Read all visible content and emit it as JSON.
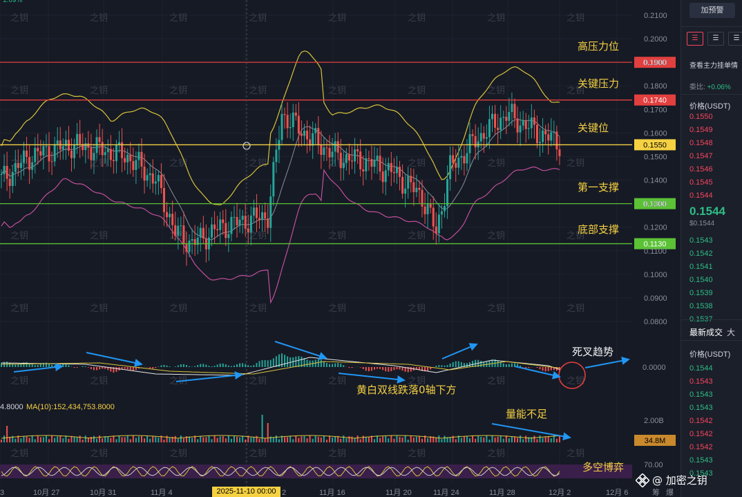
{
  "chart_data": {
    "type": "candlestick",
    "price_axis": {
      "ticks": [
        "0.2100",
        "0.2000",
        "0.1900",
        "0.1800",
        "0.1700",
        "0.1600",
        "0.1500",
        "0.1400",
        "0.1300",
        "0.1200",
        "0.1100",
        "0.1000",
        "0.0900",
        "0.0800"
      ],
      "range": [
        0.08,
        0.21
      ]
    },
    "macd_axis": {
      "ticks": [
        "0.0000"
      ]
    },
    "volume_axis": {
      "ticks": [
        "2.00B"
      ]
    },
    "osc_axis": {
      "ticks": [
        "70.00"
      ]
    },
    "x_ticks": [
      "3",
      "10月 27",
      "10月 31",
      "11月 4",
      "11月 12",
      "11月 16",
      "11月 20",
      "11月 24",
      "11月 28",
      "12月 2",
      "12月 6"
    ],
    "crosshair_time": "2025-11-10 00:00",
    "levels": [
      {
        "name": "高压力位",
        "price": "0.1900",
        "color": "#e23f3f"
      },
      {
        "name": "关键压力",
        "price": "0.1740",
        "color": "#e23f3f"
      },
      {
        "name": "关键位",
        "price": "0.1550",
        "color": "#f5d142"
      },
      {
        "name": "第一支撑",
        "price": "0.1300",
        "color": "#5bc236"
      },
      {
        "name": "底部支撑",
        "price": "0.1130",
        "color": "#5bc236"
      }
    ],
    "annotations": {
      "death_cross": "死叉趋势",
      "macd_note": "黄白双线跌落0轴下方",
      "volume_note": "量能不足",
      "osc_note": "多空博弈"
    },
    "volume_label": "MA(10):152,434,753.8000",
    "volume_prefix": "4.8000",
    "volume_badge": "34.8M",
    "header_fragment": "1.69%"
  },
  "watermark": "之钥",
  "side_panel": {
    "alert_button": "加预警",
    "view_label": "查看主力挂单情",
    "ratio_label": "委比:",
    "ratio_value": "+0.06%",
    "price_header": "价格(USDT)",
    "asks": [
      "0.1550",
      "0.1549",
      "0.1548",
      "0.1547",
      "0.1546",
      "0.1545",
      "0.1544"
    ],
    "last_price": "0.1544",
    "last_usd": "$0.1544",
    "bids": [
      "0.1543",
      "0.1542",
      "0.1541",
      "0.1540",
      "0.1539",
      "0.1538",
      "0.1537"
    ],
    "trades_tab": "最新成交",
    "trades_tab2": "大",
    "trades_header": "价格(USDT)",
    "trades": [
      {
        "price": "0.1544",
        "side": "buy"
      },
      {
        "price": "0.1543",
        "side": "sell"
      },
      {
        "price": "0.1543",
        "side": "buy"
      },
      {
        "price": "0.1543",
        "side": "buy"
      },
      {
        "price": "0.1542",
        "side": "sell"
      },
      {
        "price": "0.1542",
        "side": "sell"
      },
      {
        "price": "0.1542",
        "side": "sell"
      },
      {
        "price": "0.1543",
        "side": "buy"
      },
      {
        "price": "0.1543",
        "side": "buy"
      }
    ],
    "bottom_labels": [
      "筹",
      "爆"
    ]
  },
  "brand": "@ 加密之钥"
}
